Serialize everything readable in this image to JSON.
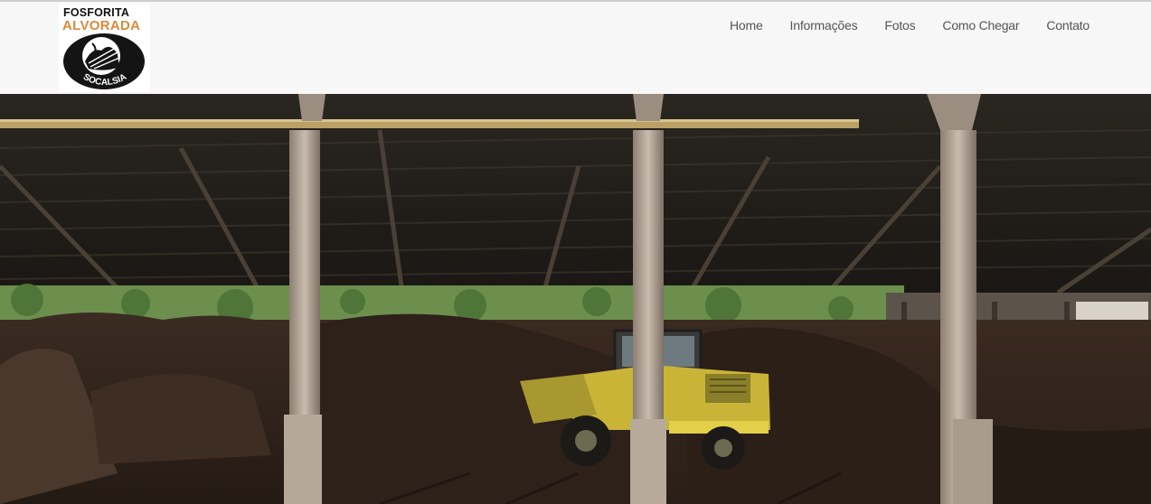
{
  "logo": {
    "line1": "FOSFORITA",
    "line2": "ALVORADA",
    "circle_text": "SOCALSIA",
    "accent_color": "#d98a3b"
  },
  "nav": {
    "items": [
      {
        "label": "Home"
      },
      {
        "label": "Informações"
      },
      {
        "label": "Fotos"
      },
      {
        "label": "Como Chegar"
      },
      {
        "label": "Contato"
      }
    ]
  },
  "hero": {
    "subject": "warehouse with phosphate rock piles and a yellow wheel loader"
  }
}
